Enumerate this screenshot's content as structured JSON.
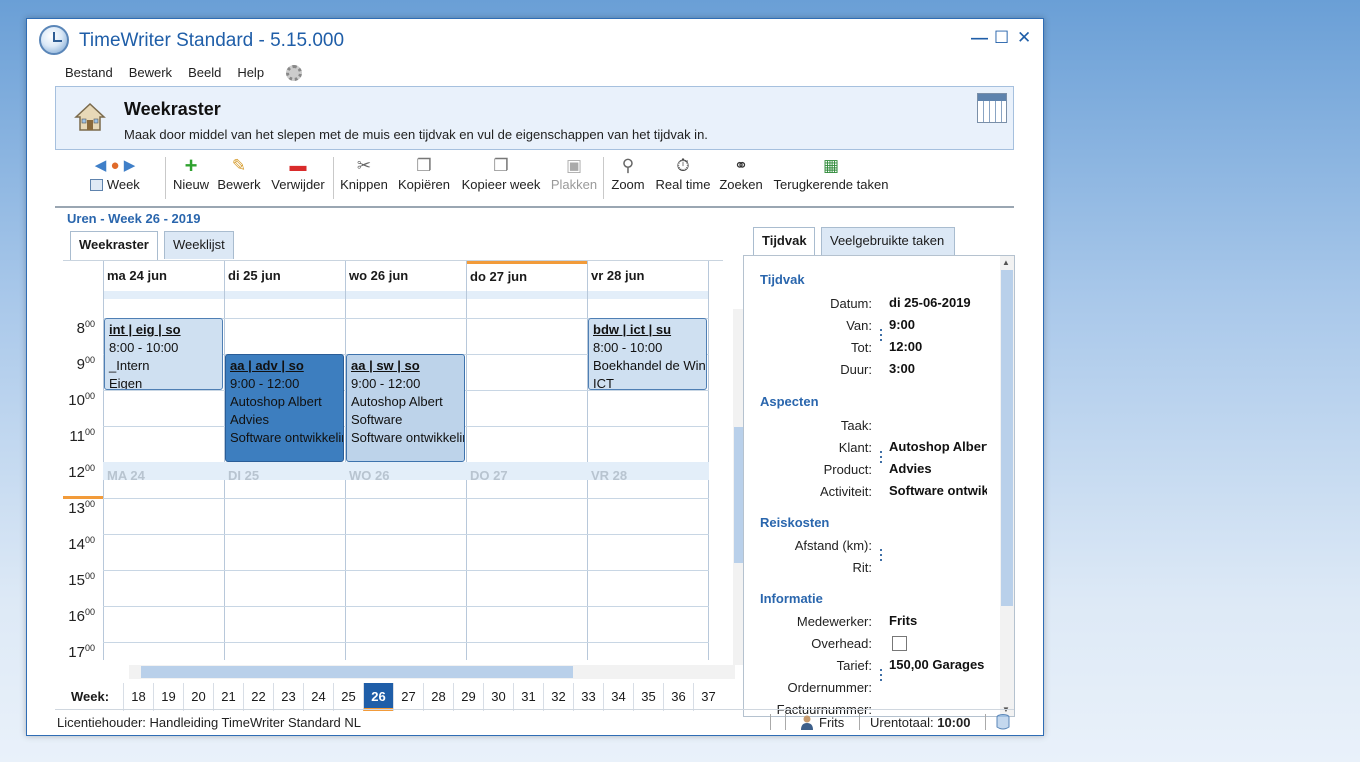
{
  "window": {
    "title": "TimeWriter Standard - 5.15.000",
    "controls": [
      "—",
      "☐",
      "✕"
    ]
  },
  "menu": [
    "Bestand",
    "Bewerk",
    "Beeld",
    "Help"
  ],
  "header": {
    "title": "Weekraster",
    "description": "Maak door middel van het slepen met de muis een tijdvak en vul de eigenschappen van het tijdvak in."
  },
  "toolbar": {
    "week": "Week",
    "nieuw": "Nieuw",
    "bewerk": "Bewerk",
    "verwijder": "Verwijder",
    "knippen": "Knippen",
    "kopieren": "Kopiëren",
    "kopieer_week": "Kopieer week",
    "plakken": "Plakken",
    "zoom": "Zoom",
    "real_time": "Real time",
    "zoeken": "Zoeken",
    "terugkerende": "Terugkerende taken"
  },
  "week_title": "Uren - Week 26 - 2019",
  "left_tabs": [
    "Weekraster",
    "Weeklijst"
  ],
  "days": [
    "ma 24 jun",
    "di 25 jun",
    "wo 26 jun",
    "do 27 jun",
    "vr 28 jun"
  ],
  "lunch_labels": [
    "MA 24",
    "DI 25",
    "WO 26",
    "DO 27",
    "VR 28"
  ],
  "hours": [
    "8",
    "9",
    "10",
    "11",
    "12",
    "13",
    "14",
    "15",
    "16",
    "17"
  ],
  "hour_sup": "00",
  "slots": [
    {
      "title": "int | eig | so",
      "time": "8:00 - 10:00",
      "line1": "_Intern",
      "line2": "Eigen"
    },
    {
      "title": "aa | adv | so",
      "time": "9:00 - 12:00",
      "line1": "Autoshop Albert",
      "line2": "Advies",
      "line3": "Software ontwikkeling"
    },
    {
      "title": "aa | sw | so",
      "time": "9:00 - 12:00",
      "line1": "Autoshop Albert",
      "line2": "Software",
      "line3": "Software ontwikkeling"
    },
    {
      "title": "bdw | ict | su",
      "time": "8:00 - 10:00",
      "line1": "Boekhandel de Wind",
      "line2": "ICT"
    }
  ],
  "weekbar": {
    "label": "Week:",
    "weeks": [
      "18",
      "19",
      "20",
      "21",
      "22",
      "23",
      "24",
      "25",
      "26",
      "27",
      "28",
      "29",
      "30",
      "31",
      "32",
      "33",
      "34",
      "35",
      "36",
      "37"
    ],
    "current": "26"
  },
  "right_tabs": [
    "Tijdvak",
    "Veelgebruikte taken"
  ],
  "details": {
    "tijdvak_title": "Tijdvak",
    "datum_label": "Datum:",
    "datum": "di 25-06-2019",
    "van_label": "Van:",
    "van": "9:00",
    "tot_label": "Tot:",
    "tot": "12:00",
    "duur_label": "Duur:",
    "duur": "3:00",
    "aspecten_title": "Aspecten",
    "taak_label": "Taak:",
    "klant_label": "Klant:",
    "klant": "Autoshop Albert",
    "product_label": "Product:",
    "product": "Advies",
    "activiteit_label": "Activiteit:",
    "activiteit": "Software ontwikkeling",
    "reiskosten_title": "Reiskosten",
    "afstand_label": "Afstand (km):",
    "rit_label": "Rit:",
    "informatie_title": "Informatie",
    "medewerker_label": "Medewerker:",
    "medewerker": "Frits",
    "overhead_label": "Overhead:",
    "tarief_label": "Tarief:",
    "tarief": "150,00 Garages",
    "ordernummer_label": "Ordernummer:",
    "factuurnummer_label": "Factuurnummer:"
  },
  "statusbar": {
    "license": "Licentiehouder: Handleiding TimeWriter Standard NL",
    "user": "Frits",
    "total_label": "Urentotaal:",
    "total": "10:00"
  },
  "colors": {
    "accent": "#1f5ea8",
    "today_marker": "#f29b3a"
  }
}
